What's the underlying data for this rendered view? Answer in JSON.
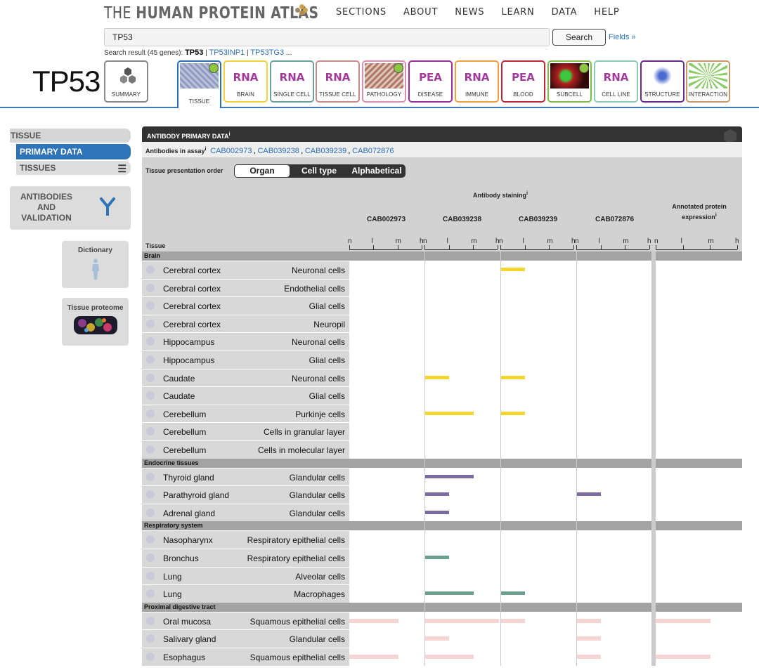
{
  "header": {
    "logo_prefix": "THE ",
    "logo_bold": "HUMAN PROTEIN ATLAS",
    "nav": [
      "SECTIONS",
      "ABOUT",
      "NEWS",
      "LEARN",
      "DATA",
      "HELP"
    ]
  },
  "search": {
    "value": "TP53",
    "button": "Search",
    "fields_link": "Fields »",
    "result_prefix": "Search result (45 genes): ",
    "result_current": "TP53",
    "result_links": [
      "TP53INP1",
      "TP53TG3"
    ],
    "result_more": "..."
  },
  "gene": "TP53",
  "tabs": [
    {
      "main": "",
      "sub": "SUMMARY",
      "color": "#888888",
      "icon": "summary-hexagons-icon"
    },
    {
      "main": "",
      "sub": "TISSUE",
      "color": "#2a6fb8",
      "icon": "tissue-image-icon",
      "dot": true,
      "active": true
    },
    {
      "main": "RNA",
      "sub": "BRAIN",
      "color": "#f2d23a"
    },
    {
      "main": "RNA",
      "sub": "SINGLE CELL",
      "color": "#6aa39a"
    },
    {
      "main": "RNA",
      "sub": "TISSUE CELL",
      "color": "#c98a8a"
    },
    {
      "main": "",
      "sub": "PATHOLOGY",
      "color": "#d98fb0",
      "icon": "pathology-image-icon",
      "dot": true
    },
    {
      "main": "PEA",
      "sub": "DISEASE",
      "color": "#9b2d9b"
    },
    {
      "main": "RNA",
      "sub": "IMMUNE",
      "color": "#f0a040"
    },
    {
      "main": "PEA",
      "sub": "BLOOD",
      "color": "#c0283a"
    },
    {
      "main": "",
      "sub": "SUBCELL",
      "color": "#7cc041",
      "icon": "subcell-image-icon",
      "dot": true
    },
    {
      "main": "RNA",
      "sub": "CELL LINE",
      "color": "#88ccb4"
    },
    {
      "main": "",
      "sub": "STRUCTURE",
      "color": "#6a2b8e",
      "icon": "structure-image-icon"
    },
    {
      "main": "",
      "sub": "INTERACTION",
      "color": "#c9966a",
      "icon": "interaction-image-icon"
    }
  ],
  "sidebar": {
    "tissue": "TISSUE",
    "primary": "PRIMARY DATA",
    "tissues": "TISSUES",
    "antibodies": [
      "ANTIBODIES",
      "AND",
      "VALIDATION"
    ],
    "dictionary": "Dictionary",
    "proteome": "Tissue proteome"
  },
  "panel": {
    "title": "ANTIBODY PRIMARY DATA",
    "assay_label": "Antibodies in assay",
    "assays": [
      "CAB002973",
      "CAB039238",
      "CAB039239",
      "CAB072876"
    ],
    "order_label": "Tissue presentation order",
    "order_options": [
      "Organ",
      "Cell type",
      "Alphabetical"
    ],
    "staining_label": "Antibody staining",
    "annotated_label": "Annotated protein expression",
    "tissue_label": "Tissue",
    "scale": [
      "n",
      "l",
      "m",
      "h"
    ],
    "colors": {
      "brain": "#f5d52f",
      "endocrine": "#7a6aa0",
      "respiratory": "#6aa090",
      "digestive": "#f5d4d4"
    }
  },
  "categories": [
    {
      "name": "Brain",
      "color": "#f5d52f",
      "rows": [
        {
          "tissue": "Cerebral cortex",
          "cell": "Neuronal cells",
          "levels": [
            0,
            0,
            1,
            0,
            0
          ]
        },
        {
          "tissue": "Cerebral cortex",
          "cell": "Endothelial cells",
          "levels": [
            0,
            0,
            0,
            0,
            0
          ]
        },
        {
          "tissue": "Cerebral cortex",
          "cell": "Glial cells",
          "levels": [
            0,
            0,
            0,
            0,
            0
          ]
        },
        {
          "tissue": "Cerebral cortex",
          "cell": "Neuropil",
          "levels": [
            0,
            0,
            0,
            0,
            0
          ]
        },
        {
          "tissue": "Hippocampus",
          "cell": "Neuronal cells",
          "levels": [
            0,
            0,
            0,
            0,
            0
          ]
        },
        {
          "tissue": "Hippocampus",
          "cell": "Glial cells",
          "levels": [
            0,
            0,
            0,
            0,
            0
          ]
        },
        {
          "tissue": "Caudate",
          "cell": "Neuronal cells",
          "levels": [
            0,
            1,
            1,
            0,
            0
          ]
        },
        {
          "tissue": "Caudate",
          "cell": "Glial cells",
          "levels": [
            0,
            0,
            0,
            0,
            0
          ]
        },
        {
          "tissue": "Cerebellum",
          "cell": "Purkinje cells",
          "levels": [
            0,
            2,
            1,
            0,
            0
          ]
        },
        {
          "tissue": "Cerebellum",
          "cell": "Cells in granular layer",
          "levels": [
            0,
            0,
            0,
            0,
            0
          ]
        },
        {
          "tissue": "Cerebellum",
          "cell": "Cells in molecular layer",
          "levels": [
            0,
            0,
            0,
            0,
            0
          ]
        }
      ]
    },
    {
      "name": "Endocrine tissues",
      "color": "#7a6aa0",
      "rows": [
        {
          "tissue": "Thyroid gland",
          "cell": "Glandular cells",
          "levels": [
            0,
            2,
            0,
            0,
            0
          ]
        },
        {
          "tissue": "Parathyroid gland",
          "cell": "Glandular cells",
          "levels": [
            0,
            1,
            0,
            1,
            0
          ]
        },
        {
          "tissue": "Adrenal gland",
          "cell": "Glandular cells",
          "levels": [
            0,
            1,
            0,
            0,
            0
          ]
        }
      ]
    },
    {
      "name": "Respiratory system",
      "color": "#6aa090",
      "rows": [
        {
          "tissue": "Nasopharynx",
          "cell": "Respiratory epithelial cells",
          "levels": [
            0,
            0,
            0,
            0,
            0
          ]
        },
        {
          "tissue": "Bronchus",
          "cell": "Respiratory epithelial cells",
          "levels": [
            0,
            1,
            0,
            0,
            0
          ]
        },
        {
          "tissue": "Lung",
          "cell": "Alveolar cells",
          "levels": [
            0,
            0,
            0,
            0,
            0
          ]
        },
        {
          "tissue": "Lung",
          "cell": "Macrophages",
          "levels": [
            0,
            2,
            1,
            0,
            0
          ]
        }
      ]
    },
    {
      "name": "Proximal digestive tract",
      "color": "#f5d4d4",
      "rows": [
        {
          "tissue": "Oral mucosa",
          "cell": "Squamous epithelial cells",
          "levels": [
            2,
            3,
            1,
            1,
            2
          ]
        },
        {
          "tissue": "Salivary gland",
          "cell": "Glandular cells",
          "levels": [
            0,
            1,
            0,
            1,
            0
          ]
        },
        {
          "tissue": "Esophagus",
          "cell": "Squamous epithelial cells",
          "levels": [
            2,
            2,
            0,
            1,
            2
          ]
        }
      ]
    }
  ]
}
